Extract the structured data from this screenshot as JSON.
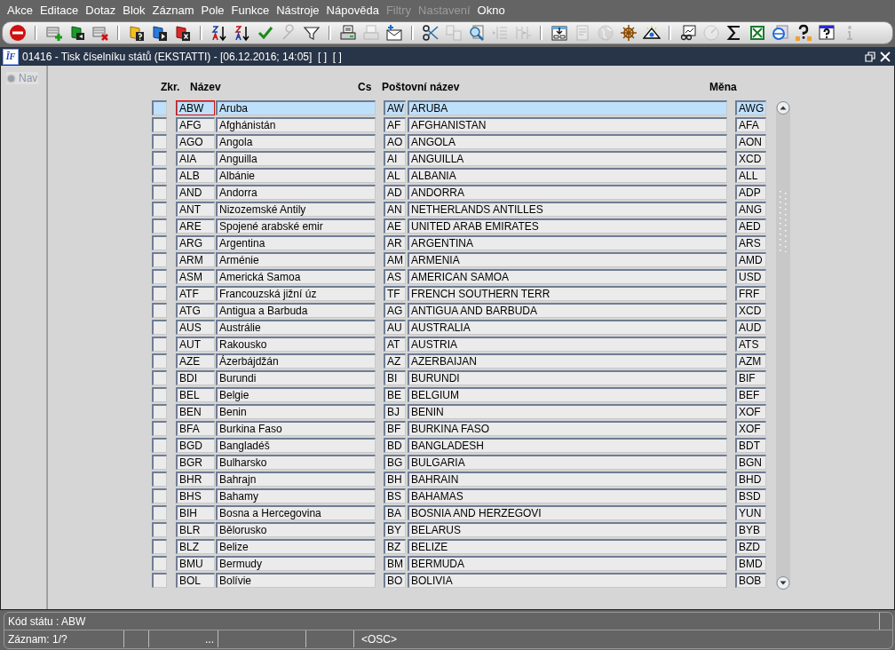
{
  "menu": [
    {
      "label": "Akce",
      "disabled": false
    },
    {
      "label": "Editace",
      "disabled": false
    },
    {
      "label": "Dotaz",
      "disabled": false
    },
    {
      "label": "Blok",
      "disabled": false
    },
    {
      "label": "Záznam",
      "disabled": false
    },
    {
      "label": "Pole",
      "disabled": false
    },
    {
      "label": "Funkce",
      "disabled": false
    },
    {
      "label": "Nástroje",
      "disabled": false
    },
    {
      "label": "Nápověda",
      "disabled": false
    },
    {
      "label": "Filtry",
      "disabled": true
    },
    {
      "label": "Nastavení",
      "disabled": true
    },
    {
      "label": "Okno",
      "disabled": false
    }
  ],
  "toolbar": [
    [
      {
        "disabled": false
      }
    ],
    [
      {
        "disabled": false
      },
      {
        "disabled": false
      },
      {
        "disabled": false
      }
    ],
    [
      {
        "disabled": false
      },
      {
        "disabled": false
      },
      {
        "disabled": false
      }
    ],
    [
      {
        "disabled": false
      },
      {
        "disabled": false
      },
      {
        "disabled": false
      },
      {
        "disabled": true
      },
      {
        "disabled": false
      }
    ],
    [
      {
        "disabled": false
      },
      {
        "disabled": true
      },
      {
        "disabled": false
      }
    ],
    [
      {
        "disabled": false
      },
      {
        "disabled": true
      },
      {
        "disabled": false
      },
      {
        "disabled": true
      },
      {
        "disabled": true
      }
    ],
    [
      {
        "disabled": false
      },
      {
        "disabled": true
      },
      {
        "disabled": true
      },
      {
        "disabled": false
      },
      {
        "disabled": false
      }
    ],
    [
      {
        "disabled": false
      },
      {
        "disabled": true
      },
      {
        "disabled": false
      },
      {
        "disabled": false
      },
      {
        "disabled": false
      },
      {
        "disabled": false
      },
      {
        "disabled": false
      },
      {
        "disabled": true
      }
    ]
  ],
  "window": {
    "logo": "ĪF",
    "title": "01416 - Tisk číselníku států (EKSTATTI) - [06.12.2016; 14:05]  [ ]  [ ]"
  },
  "nav": {
    "label": "Nav",
    "disabled": true
  },
  "table": {
    "columns": [
      "Zkr.",
      "Název",
      "Cs",
      "Poštovní název",
      "Měna"
    ],
    "rows": [
      {
        "code": "ABW",
        "name": "Aruba",
        "cs": "AW",
        "postal": "ARUBA",
        "currency": "AWG",
        "selected": true,
        "focused": true
      },
      {
        "code": "AFG",
        "name": "Afghánistán",
        "cs": "AF",
        "postal": "AFGHANISTAN",
        "currency": "AFA",
        "selected": false,
        "focused": false
      },
      {
        "code": "AGO",
        "name": "Angola",
        "cs": "AO",
        "postal": "ANGOLA",
        "currency": "AON",
        "selected": false,
        "focused": false
      },
      {
        "code": "AIA",
        "name": "Anguilla",
        "cs": "AI",
        "postal": "ANGUILLA",
        "currency": "XCD",
        "selected": false,
        "focused": false
      },
      {
        "code": "ALB",
        "name": "Albánie",
        "cs": "AL",
        "postal": "ALBANIA",
        "currency": "ALL",
        "selected": false,
        "focused": false
      },
      {
        "code": "AND",
        "name": "Andorra",
        "cs": "AD",
        "postal": "ANDORRA",
        "currency": "ADP",
        "selected": false,
        "focused": false
      },
      {
        "code": "ANT",
        "name": "Nizozemské Antily",
        "cs": "AN",
        "postal": "NETHERLANDS ANTILLES",
        "currency": "ANG",
        "selected": false,
        "focused": false
      },
      {
        "code": "ARE",
        "name": "Spojené arabské emir",
        "cs": "AE",
        "postal": "UNITED ARAB EMIRATES",
        "currency": "AED",
        "selected": false,
        "focused": false
      },
      {
        "code": "ARG",
        "name": "Argentina",
        "cs": "AR",
        "postal": "ARGENTINA",
        "currency": "ARS",
        "selected": false,
        "focused": false
      },
      {
        "code": "ARM",
        "name": "Arménie",
        "cs": "AM",
        "postal": "ARMENIA",
        "currency": "AMD",
        "selected": false,
        "focused": false
      },
      {
        "code": "ASM",
        "name": "Americká Samoa",
        "cs": "AS",
        "postal": "AMERICAN SAMOA",
        "currency": "USD",
        "selected": false,
        "focused": false
      },
      {
        "code": "ATF",
        "name": "Francouzská jižní úz",
        "cs": "TF",
        "postal": "FRENCH SOUTHERN TERR",
        "currency": "FRF",
        "selected": false,
        "focused": false
      },
      {
        "code": "ATG",
        "name": "Antigua a Barbuda",
        "cs": "AG",
        "postal": "ANTIGUA AND BARBUDA",
        "currency": "XCD",
        "selected": false,
        "focused": false
      },
      {
        "code": "AUS",
        "name": "Austrálie",
        "cs": "AU",
        "postal": "AUSTRALIA",
        "currency": "AUD",
        "selected": false,
        "focused": false
      },
      {
        "code": "AUT",
        "name": "Rakousko",
        "cs": "AT",
        "postal": "AUSTRIA",
        "currency": "ATS",
        "selected": false,
        "focused": false
      },
      {
        "code": "AZE",
        "name": "Ázerbájdžán",
        "cs": "AZ",
        "postal": "AZERBAIJAN",
        "currency": "AZM",
        "selected": false,
        "focused": false
      },
      {
        "code": "BDI",
        "name": "Burundi",
        "cs": "BI",
        "postal": "BURUNDI",
        "currency": "BIF",
        "selected": false,
        "focused": false
      },
      {
        "code": "BEL",
        "name": "Belgie",
        "cs": "BE",
        "postal": "BELGIUM",
        "currency": "BEF",
        "selected": false,
        "focused": false
      },
      {
        "code": "BEN",
        "name": "Benin",
        "cs": "BJ",
        "postal": "BENIN",
        "currency": "XOF",
        "selected": false,
        "focused": false
      },
      {
        "code": "BFA",
        "name": "Burkina Faso",
        "cs": "BF",
        "postal": "BURKINA FASO",
        "currency": "XOF",
        "selected": false,
        "focused": false
      },
      {
        "code": "BGD",
        "name": "Bangladéš",
        "cs": "BD",
        "postal": "BANGLADESH",
        "currency": "BDT",
        "selected": false,
        "focused": false
      },
      {
        "code": "BGR",
        "name": "Bulharsko",
        "cs": "BG",
        "postal": "BULGARIA",
        "currency": "BGN",
        "selected": false,
        "focused": false
      },
      {
        "code": "BHR",
        "name": "Bahrajn",
        "cs": "BH",
        "postal": "BAHRAIN",
        "currency": "BHD",
        "selected": false,
        "focused": false
      },
      {
        "code": "BHS",
        "name": "Bahamy",
        "cs": "BS",
        "postal": "BAHAMAS",
        "currency": "BSD",
        "selected": false,
        "focused": false
      },
      {
        "code": "BIH",
        "name": "Bosna a Hercegovina",
        "cs": "BA",
        "postal": "BOSNIA AND HERZEGOVI",
        "currency": "YUN",
        "selected": false,
        "focused": false
      },
      {
        "code": "BLR",
        "name": "Bělorusko",
        "cs": "BY",
        "postal": "BELARUS",
        "currency": "BYB",
        "selected": false,
        "focused": false
      },
      {
        "code": "BLZ",
        "name": "Belize",
        "cs": "BZ",
        "postal": "BELIZE",
        "currency": "BZD",
        "selected": false,
        "focused": false
      },
      {
        "code": "BMU",
        "name": "Bermudy",
        "cs": "BM",
        "postal": "BERMUDA",
        "currency": "BMD",
        "selected": false,
        "focused": false
      },
      {
        "code": "BOL",
        "name": "Bolívie",
        "cs": "BO",
        "postal": "BOLIVIA",
        "currency": "BOB",
        "selected": false,
        "focused": false
      }
    ]
  },
  "status_bar": {
    "message": "Kód státu : ABW",
    "record": "Záznam: 1/?",
    "field_3": "...",
    "mode": "<OSC>"
  }
}
